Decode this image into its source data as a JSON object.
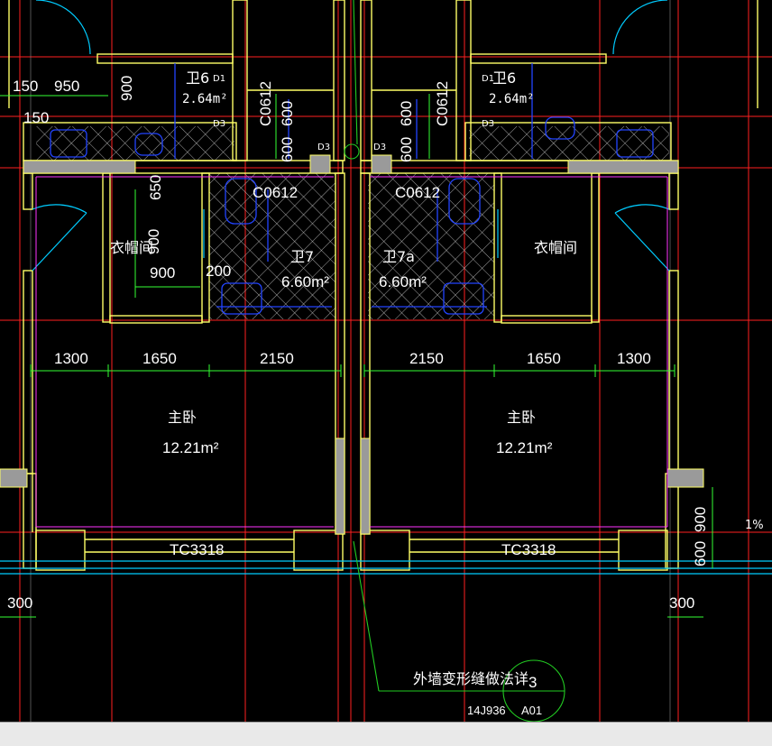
{
  "colors": {
    "background": "#000000",
    "wall": "#ffff66",
    "axis": "#ff2020",
    "dimension": "#33ff33",
    "fixture": "#1f3dff",
    "hatch": "#cfcfcf",
    "door": "#00d0ff",
    "annotation": "#ffffff",
    "magenta": "#ff33ff",
    "leader": "#22cc22"
  },
  "rooms": {
    "left_master": {
      "name": "主卧",
      "area": "12.21m²"
    },
    "right_master": {
      "name": "主卧",
      "area": "12.21m²"
    },
    "left_closet": "衣帽间",
    "right_closet": "衣帽间",
    "left_bath": {
      "name": "卫7",
      "area": "6.60m²"
    },
    "right_bath": {
      "name": "卫7a",
      "area": "6.60m²"
    },
    "left_small_bath": {
      "name": "卫6",
      "area": "2.64m²"
    },
    "right_small_bath": {
      "name": "卫6",
      "area": "2.64m²"
    }
  },
  "windows": {
    "left_bath_window": "C0612",
    "right_bath_window": "C0612",
    "left_shaft_window": "C0612",
    "right_shaft_window": "C0612",
    "left_bedroom_window": "TC3318",
    "right_bedroom_window": "TC3318"
  },
  "dimensions": {
    "top_left_150": "150",
    "top_left_950": "950",
    "top_left_900v": "900",
    "top_left_150b": "150",
    "closet_650": "650",
    "closet_900v": "900",
    "closet_900h": "900",
    "closet_200": "200",
    "shaft_l_600a": "600",
    "shaft_l_600b": "600",
    "shaft_r_600a": "600",
    "shaft_r_600b": "600",
    "left_1300": "1300",
    "left_1650": "1650",
    "left_2150": "2150",
    "right_2150": "2150",
    "right_1650": "1650",
    "right_1300": "1300",
    "bottom_left_300": "300",
    "bottom_right_300": "300",
    "right_900v": "900",
    "right_600v": "600"
  },
  "small_labels": {
    "d1_left": "D1",
    "d3_left": "D3",
    "d1_right": "D1",
    "d3_right": "D3",
    "d3_shaft_l": "D3",
    "d3_shaft_r": "D3",
    "slope": "1%"
  },
  "callout": {
    "text": "外墙变形缝做法详",
    "atlas": "14J936",
    "detail_number": "3",
    "sheet": "A01"
  }
}
